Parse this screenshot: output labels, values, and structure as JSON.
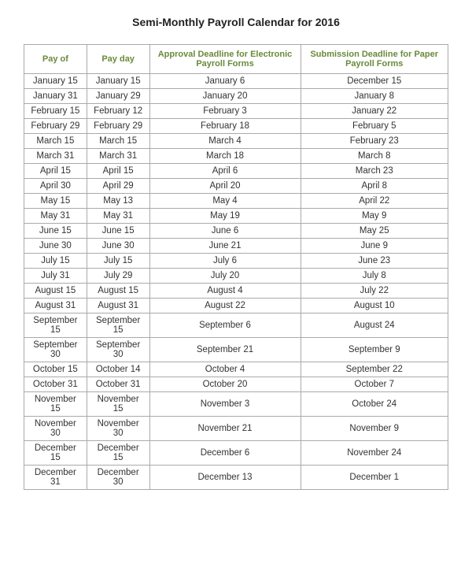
{
  "title": "Semi-Monthly Payroll Calendar for 2016",
  "columns": [
    "Pay of",
    "Pay day",
    "Approval Deadline for Electronic Payroll Forms",
    "Submission Deadline for Paper Payroll Forms"
  ],
  "rows": [
    [
      "January 15",
      "January 15",
      "January 6",
      "December 15"
    ],
    [
      "January 31",
      "January 29",
      "January 20",
      "January 8"
    ],
    [
      "February 15",
      "February 12",
      "February 3",
      "January 22"
    ],
    [
      "February 29",
      "February 29",
      "February 18",
      "February 5"
    ],
    [
      "March 15",
      "March 15",
      "March 4",
      "February 23"
    ],
    [
      "March 31",
      "March 31",
      "March 18",
      "March 8"
    ],
    [
      "April 15",
      "April 15",
      "April 6",
      "March 23"
    ],
    [
      "April 30",
      "April 29",
      "April 20",
      "April 8"
    ],
    [
      "May 15",
      "May 13",
      "May 4",
      "April 22"
    ],
    [
      "May 31",
      "May 31",
      "May 19",
      "May 9"
    ],
    [
      "June 15",
      "June 15",
      "June 6",
      "May 25"
    ],
    [
      "June 30",
      "June 30",
      "June 21",
      "June 9"
    ],
    [
      "July 15",
      "July 15",
      "July 6",
      "June 23"
    ],
    [
      "July 31",
      "July 29",
      "July 20",
      "July 8"
    ],
    [
      "August 15",
      "August 15",
      "August 4",
      "July 22"
    ],
    [
      "August 31",
      "August 31",
      "August 22",
      "August 10"
    ],
    [
      "September 15",
      "September 15",
      "September 6",
      "August 24"
    ],
    [
      "September 30",
      "September 30",
      "September 21",
      "September 9"
    ],
    [
      "October 15",
      "October 14",
      "October 4",
      "September 22"
    ],
    [
      "October 31",
      "October 31",
      "October 20",
      "October 7"
    ],
    [
      "November 15",
      "November 15",
      "November 3",
      "October 24"
    ],
    [
      "November 30",
      "November 30",
      "November 21",
      "November 9"
    ],
    [
      "December 15",
      "December 15",
      "December 6",
      "November 24"
    ],
    [
      "December 31",
      "December 30",
      "December 13",
      "December 1"
    ]
  ]
}
